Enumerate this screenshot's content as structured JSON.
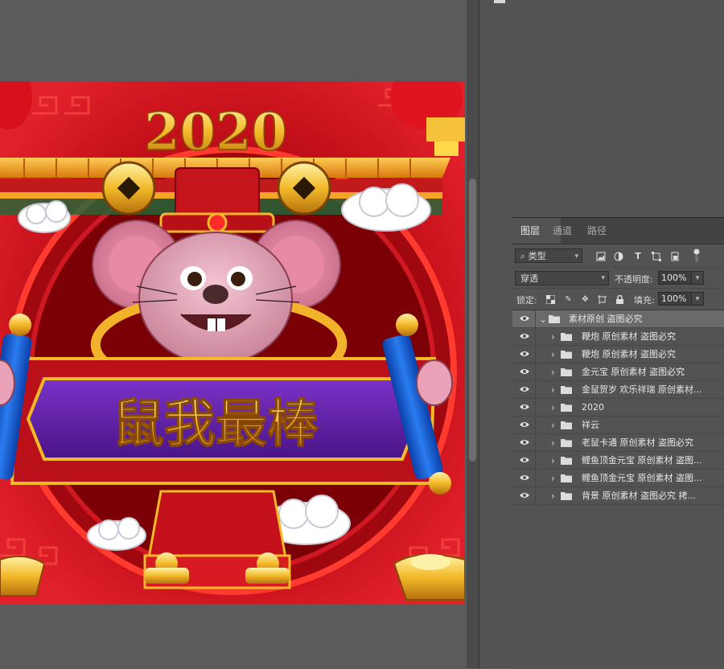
{
  "artwork": {
    "year": "2020",
    "banner_text": "鼠我最棒"
  },
  "layers_panel": {
    "tabs": [
      "图层",
      "通道",
      "路径"
    ],
    "filter_kind": "类型",
    "blend_mode": "穿透",
    "opacity_label": "不透明度:",
    "opacity_value": "100%",
    "lock_label": "锁定:",
    "fill_label": "填充:",
    "fill_value": "100%",
    "group": {
      "name": "素材原创 盗图必究",
      "expanded": true
    },
    "layers": [
      {
        "name": "鞭炮 原创素材 盗图必究"
      },
      {
        "name": "鞭炮 原创素材 盗图必究"
      },
      {
        "name": "金元宝 原创素材 盗图必究"
      },
      {
        "name": "金鼠贺岁 欢乐祥瑞 原创素材..."
      },
      {
        "name": "2020"
      },
      {
        "name": "祥云"
      },
      {
        "name": "老鼠卡通 原创素材 盗图必究"
      },
      {
        "name": "鲤鱼顶金元宝 原创素材 盗图..."
      },
      {
        "name": "鲤鱼顶金元宝 原创素材 盗图..."
      },
      {
        "name": "背景 原创素材 盗图必究 拷..."
      }
    ]
  },
  "colors": {
    "workspace_bg": "#5b5b5b",
    "panel_bg": "#535353",
    "selected_row": "#6a6a6a",
    "art_red": "#c8101a",
    "art_gold": "#f5c23a",
    "art_purple": "#5a1e9a"
  }
}
